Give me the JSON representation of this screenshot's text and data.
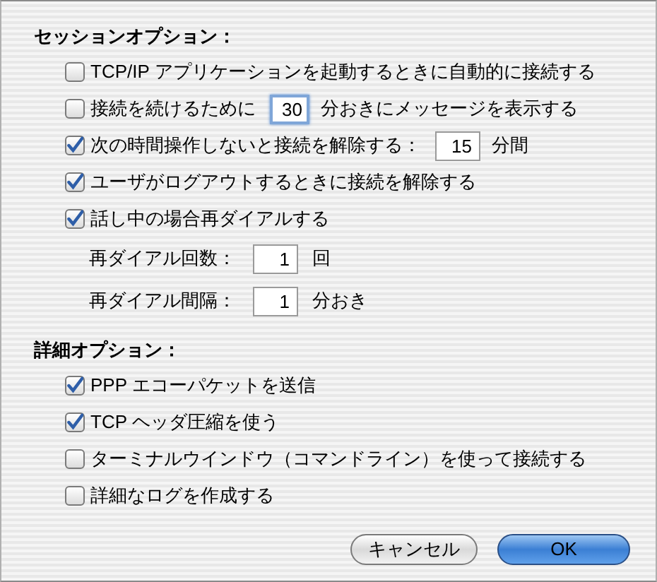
{
  "sections": [
    {
      "title": "セッションオプション：",
      "items": [
        {
          "kind": "checkbox",
          "checked": false,
          "label": "TCP/IP アプリケーションを起動するときに自動的に接続する"
        },
        {
          "kind": "checkbox",
          "checked": false,
          "label": "接続を続けるために",
          "field": {
            "value": "30",
            "focused": true
          },
          "suffix": "分おきにメッセージを表示する"
        },
        {
          "kind": "checkbox",
          "checked": true,
          "label": "次の時間操作しないと接続を解除する：",
          "field": {
            "value": "15",
            "focused": false
          },
          "suffix": "分間"
        },
        {
          "kind": "checkbox",
          "checked": true,
          "label": "ユーザがログアウトするときに接続を解除する"
        },
        {
          "kind": "checkbox",
          "checked": true,
          "label": "話し中の場合再ダイアルする"
        },
        {
          "kind": "number",
          "label": "再ダイアル回数：",
          "field": {
            "value": "1",
            "focused": false
          },
          "suffix": "回"
        },
        {
          "kind": "number",
          "label": "再ダイアル間隔：",
          "field": {
            "value": "1",
            "focused": false
          },
          "suffix": "分おき"
        }
      ]
    },
    {
      "title": "詳細オプション：",
      "items": [
        {
          "kind": "checkbox",
          "checked": true,
          "label": "PPP エコーパケットを送信"
        },
        {
          "kind": "checkbox",
          "checked": true,
          "label": "TCP ヘッダ圧縮を使う"
        },
        {
          "kind": "checkbox",
          "checked": false,
          "label": "ターミナルウインドウ（コマンドライン）を使って接続する"
        },
        {
          "kind": "checkbox",
          "checked": false,
          "label": "詳細なログを作成する"
        }
      ]
    }
  ],
  "buttons": [
    {
      "label": "キャンセル",
      "default": false
    },
    {
      "label": "OK",
      "default": true
    }
  ]
}
